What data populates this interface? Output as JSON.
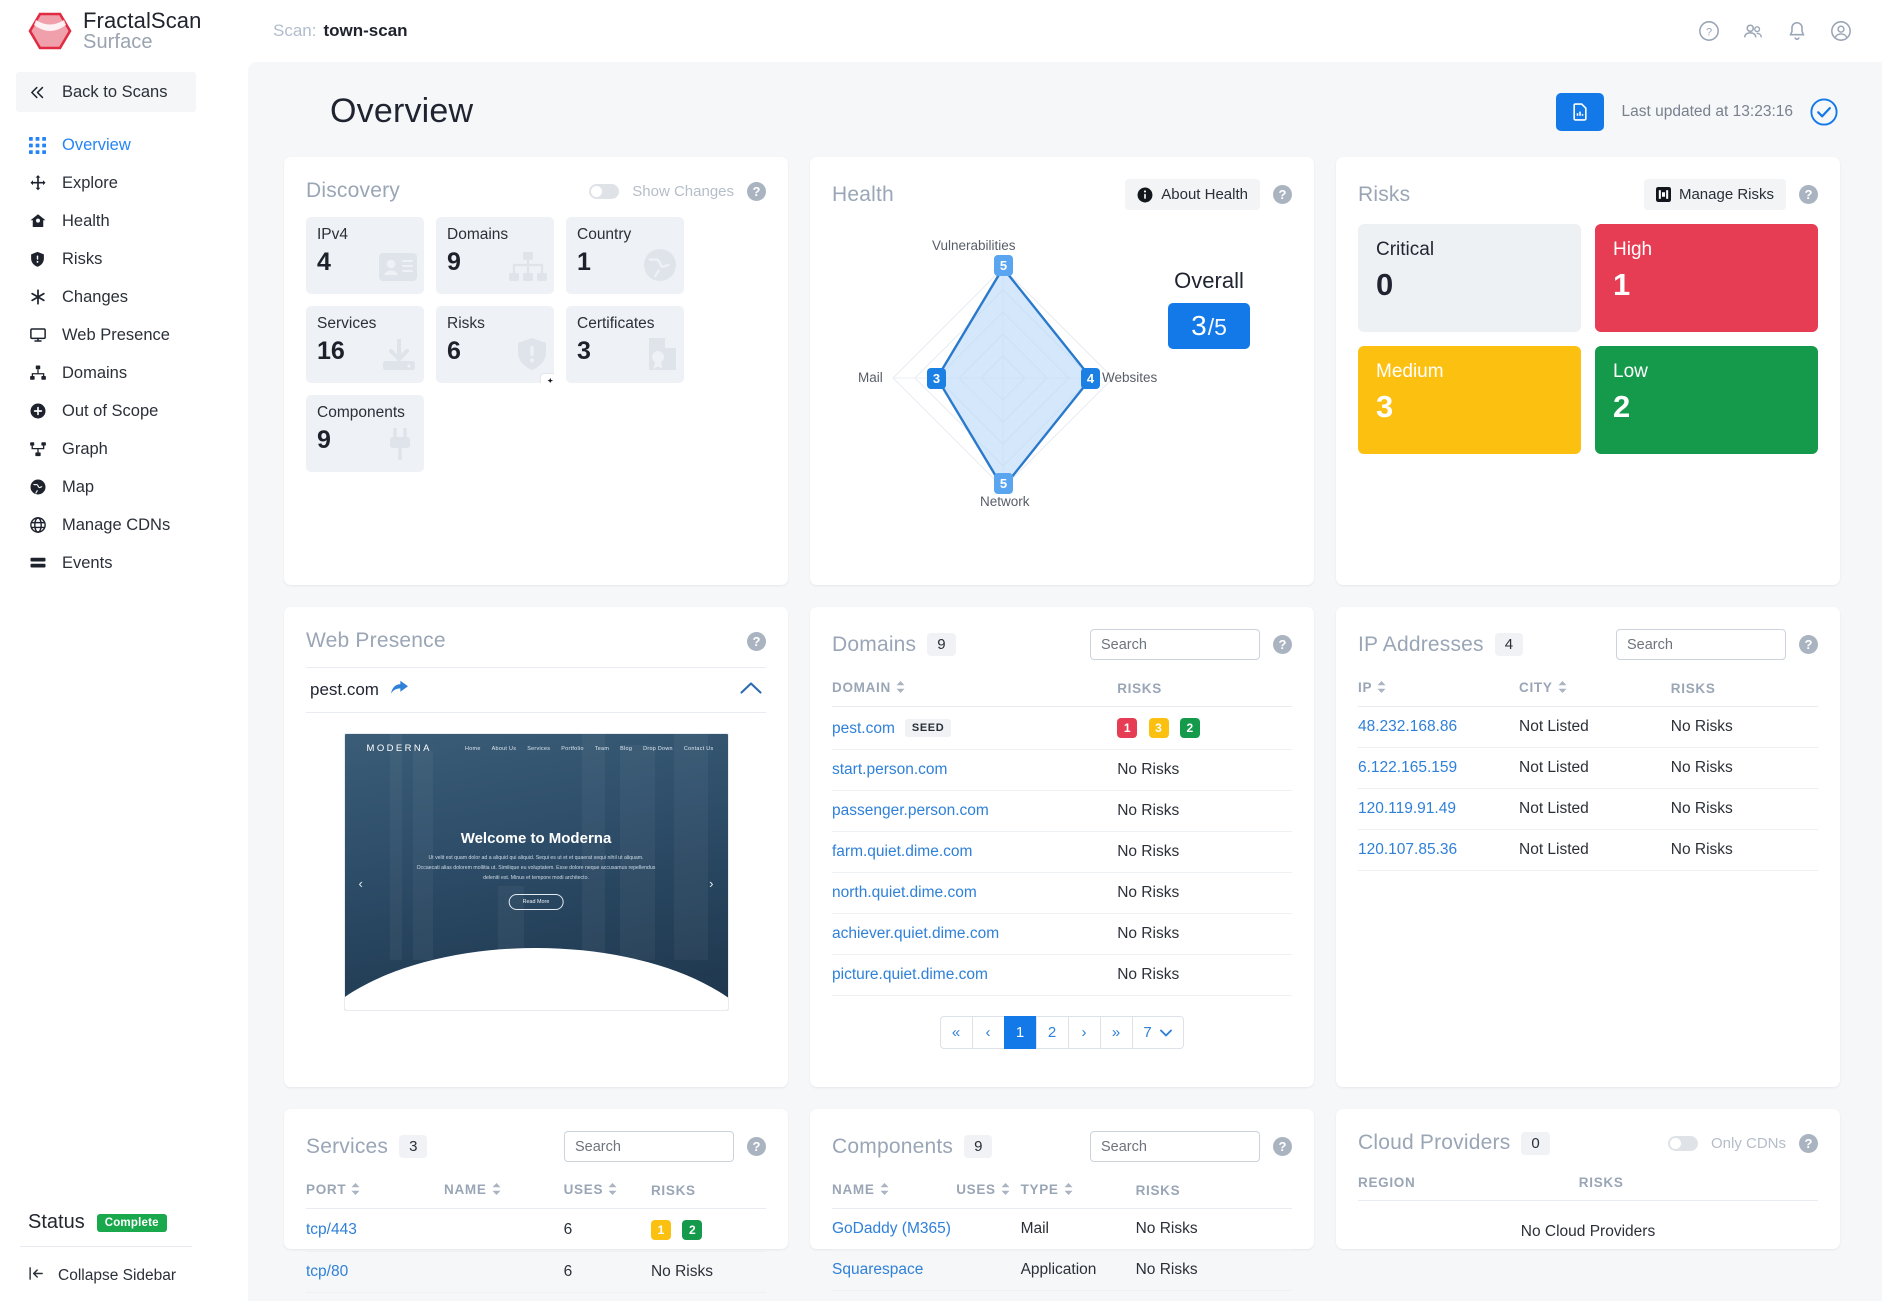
{
  "brand": {
    "line1": "FractalScan",
    "line2": "Surface"
  },
  "topbar": {
    "scan_label": "Scan:",
    "scan_name": "town-scan",
    "icons": [
      "help-icon",
      "people-icon",
      "bell-icon",
      "account-icon"
    ]
  },
  "sidebar": {
    "back_label": "Back to Scans",
    "items": [
      {
        "label": "Overview",
        "icon": "grid-icon",
        "active": true
      },
      {
        "label": "Explore",
        "icon": "move-icon",
        "active": false
      },
      {
        "label": "Health",
        "icon": "home-icon",
        "active": false
      },
      {
        "label": "Risks",
        "icon": "shield-icon",
        "active": false
      },
      {
        "label": "Changes",
        "icon": "asterisk-icon",
        "active": false
      },
      {
        "label": "Web Presence",
        "icon": "monitor-icon",
        "active": false
      },
      {
        "label": "Domains",
        "icon": "sitemap-icon",
        "active": false
      },
      {
        "label": "Out of Scope",
        "icon": "plus-circle-icon",
        "active": false
      },
      {
        "label": "Graph",
        "icon": "graph-icon",
        "active": false
      },
      {
        "label": "Map",
        "icon": "globe-icon",
        "active": false
      },
      {
        "label": "Manage CDNs",
        "icon": "world-icon",
        "active": false
      },
      {
        "label": "Events",
        "icon": "list-icon",
        "active": false
      }
    ],
    "status_label": "Status",
    "status_value": "Complete",
    "collapse_label": "Collapse Sidebar"
  },
  "page": {
    "title": "Overview",
    "last_updated": "Last updated at 13:23:16",
    "report_icon": "report-file-icon",
    "status_icon": "check-circle-icon"
  },
  "discovery": {
    "title": "Discovery",
    "show_changes_label": "Show Changes",
    "show_changes_on": false,
    "tiles": [
      {
        "label": "IPv4",
        "value": "4",
        "icon": "id-card-icon"
      },
      {
        "label": "Domains",
        "value": "9",
        "icon": "sitemap-icon"
      },
      {
        "label": "Country",
        "value": "1",
        "icon": "globe-icon"
      },
      {
        "label": "Services",
        "value": "16",
        "icon": "download-icon"
      },
      {
        "label": "Risks",
        "value": "6",
        "icon": "shield-alert-icon"
      },
      {
        "label": "Certificates",
        "value": "3",
        "icon": "certificate-icon"
      },
      {
        "label": "Components",
        "value": "9",
        "icon": "plug-icon"
      }
    ]
  },
  "health": {
    "title": "Health",
    "about_label": "About Health",
    "overall_label": "Overall",
    "overall_value": "3",
    "overall_max": "/5"
  },
  "chart_data": {
    "type": "radar",
    "title": "Health",
    "categories": [
      "Vulnerabilities",
      "Websites",
      "Network",
      "Mail"
    ],
    "values": [
      5,
      4,
      5,
      3
    ],
    "rmax": 5,
    "rings": 5,
    "grid": true,
    "legend": false,
    "overall": "3/5",
    "series": [
      {
        "name": "Health",
        "values": [
          5,
          4,
          5,
          3
        ]
      }
    ]
  },
  "risks": {
    "title": "Risks",
    "manage_label": "Manage Risks",
    "tiles": [
      {
        "label": "Critical",
        "value": "0",
        "color": "#eef1f4"
      },
      {
        "label": "High",
        "value": "1",
        "color": "#e63c54"
      },
      {
        "label": "Medium",
        "value": "3",
        "color": "#fcc011"
      },
      {
        "label": "Low",
        "value": "2",
        "color": "#159a4c"
      }
    ]
  },
  "web_presence": {
    "title": "Web Presence",
    "domain": "pest.com",
    "screenshot": {
      "logo": "MODERNA",
      "nav": [
        "Home",
        "About Us",
        "Services",
        "Portfolio",
        "Team",
        "Blog",
        "Drop Down",
        "Contact Us"
      ],
      "heading": "Welcome to Moderna",
      "paragraph": "Ut velit est quam dolor ad a aliquid qui aliquid. Sequi es ut et et quaerat sequi nihil ut aliquam. Occaecati alias dolorem mollitia ut. Similique eu voluptatem. Esse dolore neque accusamus repellendus deleniti est. Minus et tempore modi architecto.",
      "button": "Read More"
    }
  },
  "domains_card": {
    "title": "Domains",
    "count": "9",
    "search_placeholder": "Search",
    "columns": [
      "DOMAIN",
      "RISKS"
    ],
    "rows": [
      {
        "domain": "pest.com",
        "seed": "SEED",
        "risks": [
          {
            "v": "1",
            "c": "high"
          },
          {
            "v": "3",
            "c": "med"
          },
          {
            "v": "2",
            "c": "low"
          }
        ]
      },
      {
        "domain": "start.person.com",
        "seed": "",
        "risks": [],
        "no_risks": "No Risks"
      },
      {
        "domain": "passenger.person.com",
        "seed": "",
        "risks": [],
        "no_risks": "No Risks"
      },
      {
        "domain": "farm.quiet.dime.com",
        "seed": "",
        "risks": [],
        "no_risks": "No Risks"
      },
      {
        "domain": "north.quiet.dime.com",
        "seed": "",
        "risks": [],
        "no_risks": "No Risks"
      },
      {
        "domain": "achiever.quiet.dime.com",
        "seed": "",
        "risks": [],
        "no_risks": "No Risks"
      },
      {
        "domain": "picture.quiet.dime.com",
        "seed": "",
        "risks": [],
        "no_risks": "No Risks"
      }
    ],
    "pagination": {
      "first": "«",
      "prev": "‹",
      "pages": [
        "1",
        "2"
      ],
      "next": "›",
      "last": "»",
      "current": "1",
      "total_pages": "7"
    }
  },
  "ip_card": {
    "title": "IP Addresses",
    "count": "4",
    "search_placeholder": "Search",
    "columns": [
      "IP",
      "CITY",
      "RISKS"
    ],
    "rows": [
      {
        "ip": "48.232.168.86",
        "city": "Not Listed",
        "risks": "No Risks"
      },
      {
        "ip": "6.122.165.159",
        "city": "Not Listed",
        "risks": "No Risks"
      },
      {
        "ip": "120.119.91.49",
        "city": "Not Listed",
        "risks": "No Risks"
      },
      {
        "ip": "120.107.85.36",
        "city": "Not Listed",
        "risks": "No Risks"
      }
    ]
  },
  "services_card": {
    "title": "Services",
    "count": "3",
    "search_placeholder": "Search",
    "columns": [
      "PORT",
      "NAME",
      "USES",
      "RISKS"
    ],
    "rows": [
      {
        "port": "tcp/443",
        "name": "",
        "uses": "6",
        "risks": [
          {
            "v": "1",
            "c": "med"
          },
          {
            "v": "2",
            "c": "low"
          }
        ]
      },
      {
        "port": "tcp/80",
        "name": "",
        "uses": "6",
        "risks": [],
        "no_risks": "No Risks"
      }
    ]
  },
  "components_card": {
    "title": "Components",
    "count": "9",
    "search_placeholder": "Search",
    "columns": [
      "NAME",
      "USES",
      "TYPE",
      "RISKS"
    ],
    "rows": [
      {
        "name": "GoDaddy (M365)",
        "uses": "",
        "type": "Mail",
        "risks": "No Risks"
      },
      {
        "name": "Squarespace",
        "uses": "",
        "type": "Application",
        "risks": "No Risks"
      }
    ]
  },
  "cloud_card": {
    "title": "Cloud Providers",
    "count": "0",
    "only_cdns_label": "Only CDNs",
    "only_cdns_on": false,
    "columns": [
      "REGION",
      "RISKS"
    ],
    "empty": "No Cloud Providers"
  }
}
